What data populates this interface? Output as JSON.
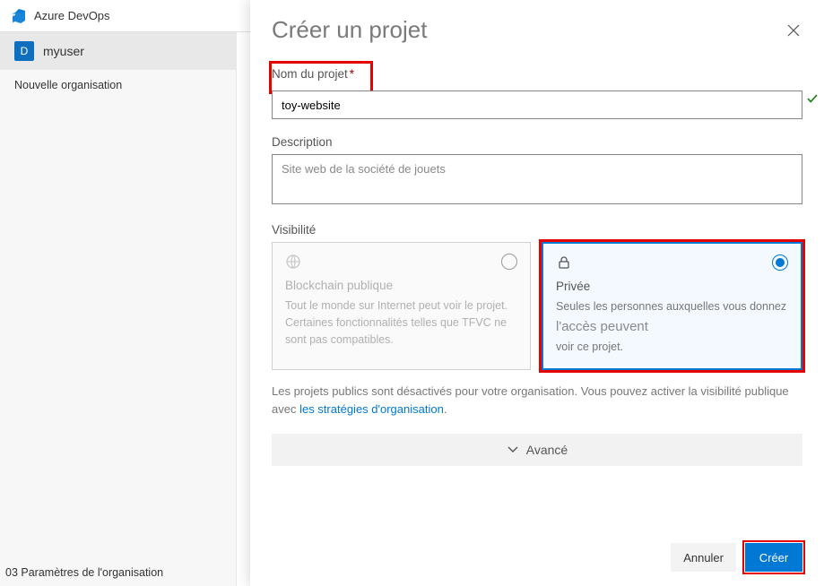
{
  "brand": {
    "name": "Azure DevOps"
  },
  "sidebar": {
    "user_initial": "D",
    "user_name": "myuser",
    "new_org_link": "Nouvelle organisation",
    "org_settings": "03 Paramètres de l'organisation"
  },
  "panel": {
    "title": "Créer un projet",
    "project_name_label": "Nom du projet",
    "project_name_value": "toy-website",
    "description_label": "Description",
    "description_value": "Site web de la société de jouets",
    "visibility_label": "Visibilité",
    "public": {
      "title": "Blockchain publique",
      "desc_line1": "Tout le monde sur Internet peut voir le projet. Certaines fonctionnalités telles que TFVC ne sont pas compatibles."
    },
    "private": {
      "title": "Privée",
      "desc_pre": "Seules les personnes auxquelles vous donnez",
      "desc_mid": "l'accès peuvent",
      "desc_post": "voir ce projet."
    },
    "hint_text": "Les projets publics sont désactivés pour votre organisation. Vous pouvez activer la visibilité publique avec ",
    "hint_link": "les stratégies d'organisation",
    "advanced_label": "Avancé",
    "cancel_label": "Annuler",
    "create_label": "Créer"
  }
}
